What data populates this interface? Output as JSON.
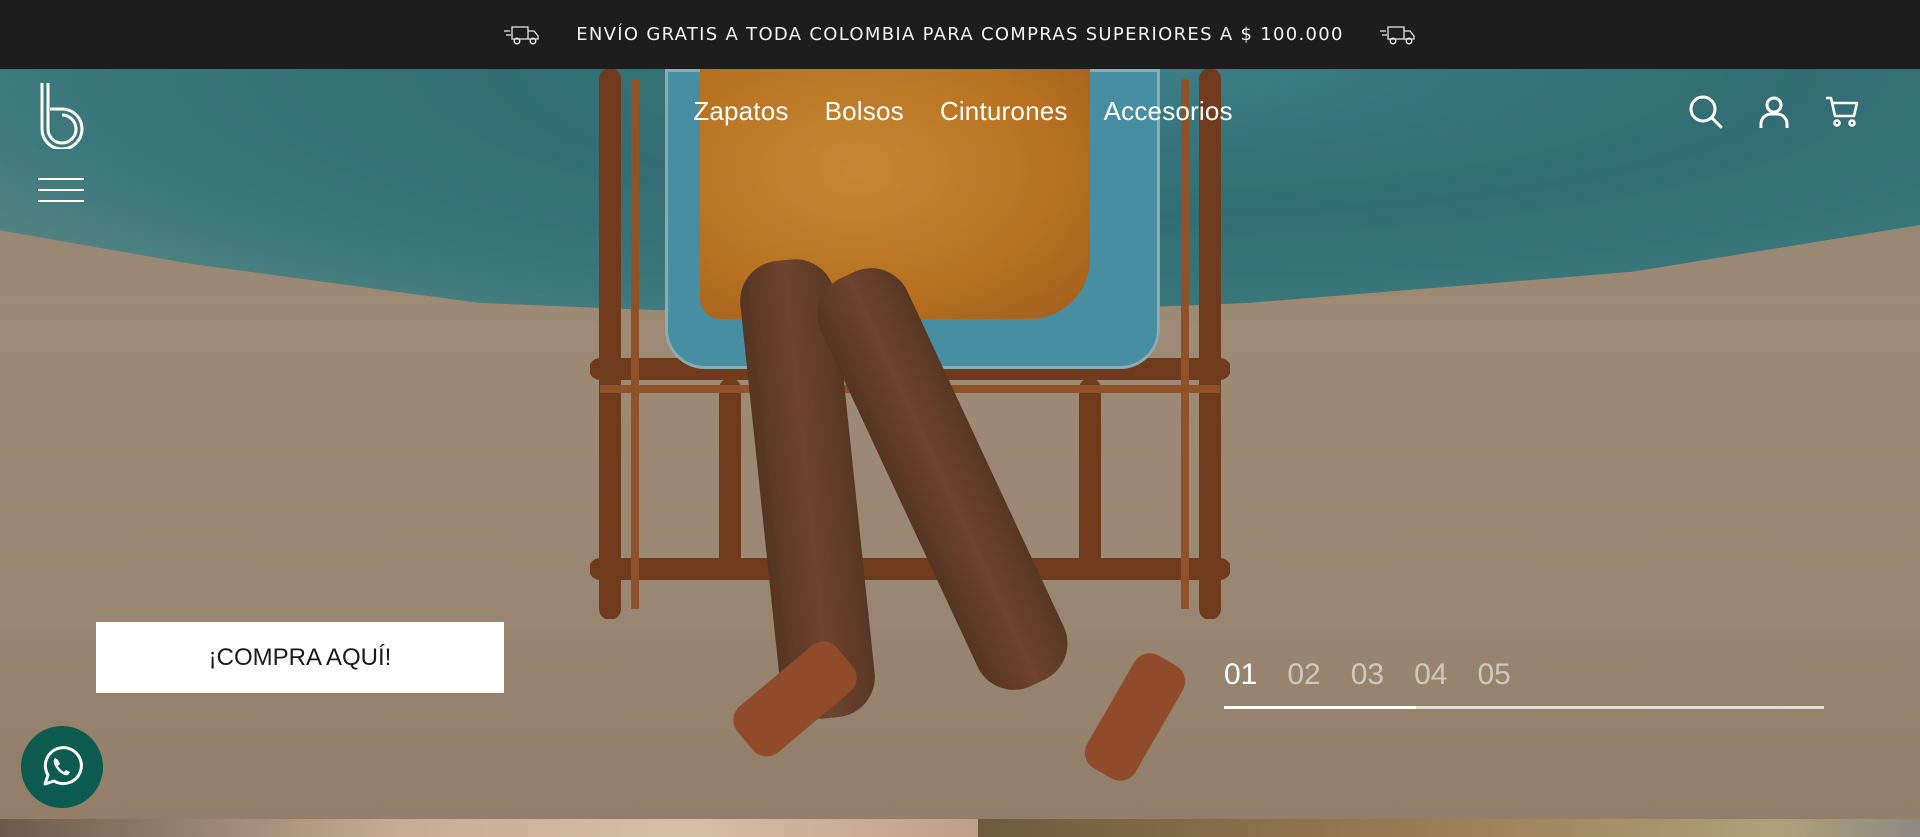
{
  "announcement": {
    "text": "ENVÍO GRATIS A TODA COLOMBIA PARA COMPRAS SUPERIORES A $ 100.000",
    "icon": "truck-icon"
  },
  "header": {
    "logo_icon": "brand-logo-b",
    "menu_icon": "hamburger-menu-icon",
    "nav": [
      "Zapatos",
      "Bolsos",
      "Cinturones",
      "Accesorios"
    ],
    "actions": [
      "search-icon",
      "user-icon",
      "cart-icon"
    ]
  },
  "hero": {
    "cta_label": "¡COMPRA AQUÍ!",
    "slides": [
      "01",
      "02",
      "03",
      "04",
      "05"
    ],
    "active_slide": 0,
    "progress": 0.32
  },
  "floating": {
    "whatsapp_icon": "whatsapp-icon"
  },
  "colors": {
    "topbar_bg": "#1d1d1d",
    "whatsapp_bg": "#0b5b4f",
    "text_light": "#ffffff"
  }
}
